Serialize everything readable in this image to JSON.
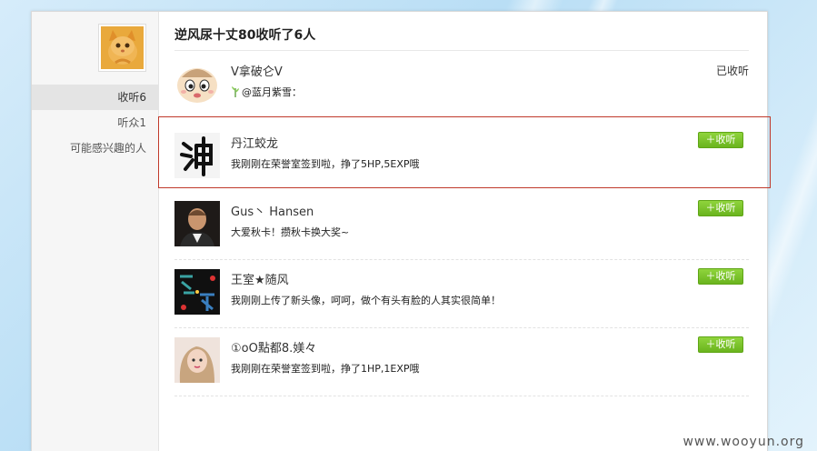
{
  "sidebar": {
    "items": [
      {
        "label": "收听6",
        "active": true
      },
      {
        "label": "听众1",
        "active": false
      },
      {
        "label": "可能感兴趣的人",
        "active": false
      }
    ]
  },
  "main": {
    "title": "逆风尿十丈80收听了6人",
    "users": [
      {
        "name": "V拿破仑V",
        "status": "@蓝月紫雪：",
        "action": "已收听",
        "followed": true,
        "avatar_icon": "cartoon-baby-face"
      },
      {
        "name": "丹江蛟龙",
        "status": "我刚刚在荣誉室签到啦，挣了5HP,5EXP哦",
        "action": "＋收听",
        "followed": false,
        "avatar_icon": "calligraphy-character"
      },
      {
        "name": "Gus丶 Hansen",
        "status": "大爱秋卡！攒秋卡换大奖~",
        "action": "＋收听",
        "followed": false,
        "avatar_icon": "man-portrait"
      },
      {
        "name": "王室★随风",
        "status": "我刚刚上传了新头像，呵呵，做个有头有脸的人其实很简单！",
        "action": "＋收听",
        "followed": false,
        "avatar_icon": "dark-text-graphic"
      },
      {
        "name": "①oO點都8.媄々",
        "status": "我刚刚在荣誉室签到啦，挣了1HP,1EXP哦",
        "action": "＋收听",
        "followed": false,
        "avatar_icon": "girl-portrait"
      }
    ]
  },
  "watermark": "www.wooyun.org",
  "colors": {
    "follow_button": "#7cc52c",
    "highlight_border": "#c0392b",
    "background": "#cfe9f9"
  }
}
